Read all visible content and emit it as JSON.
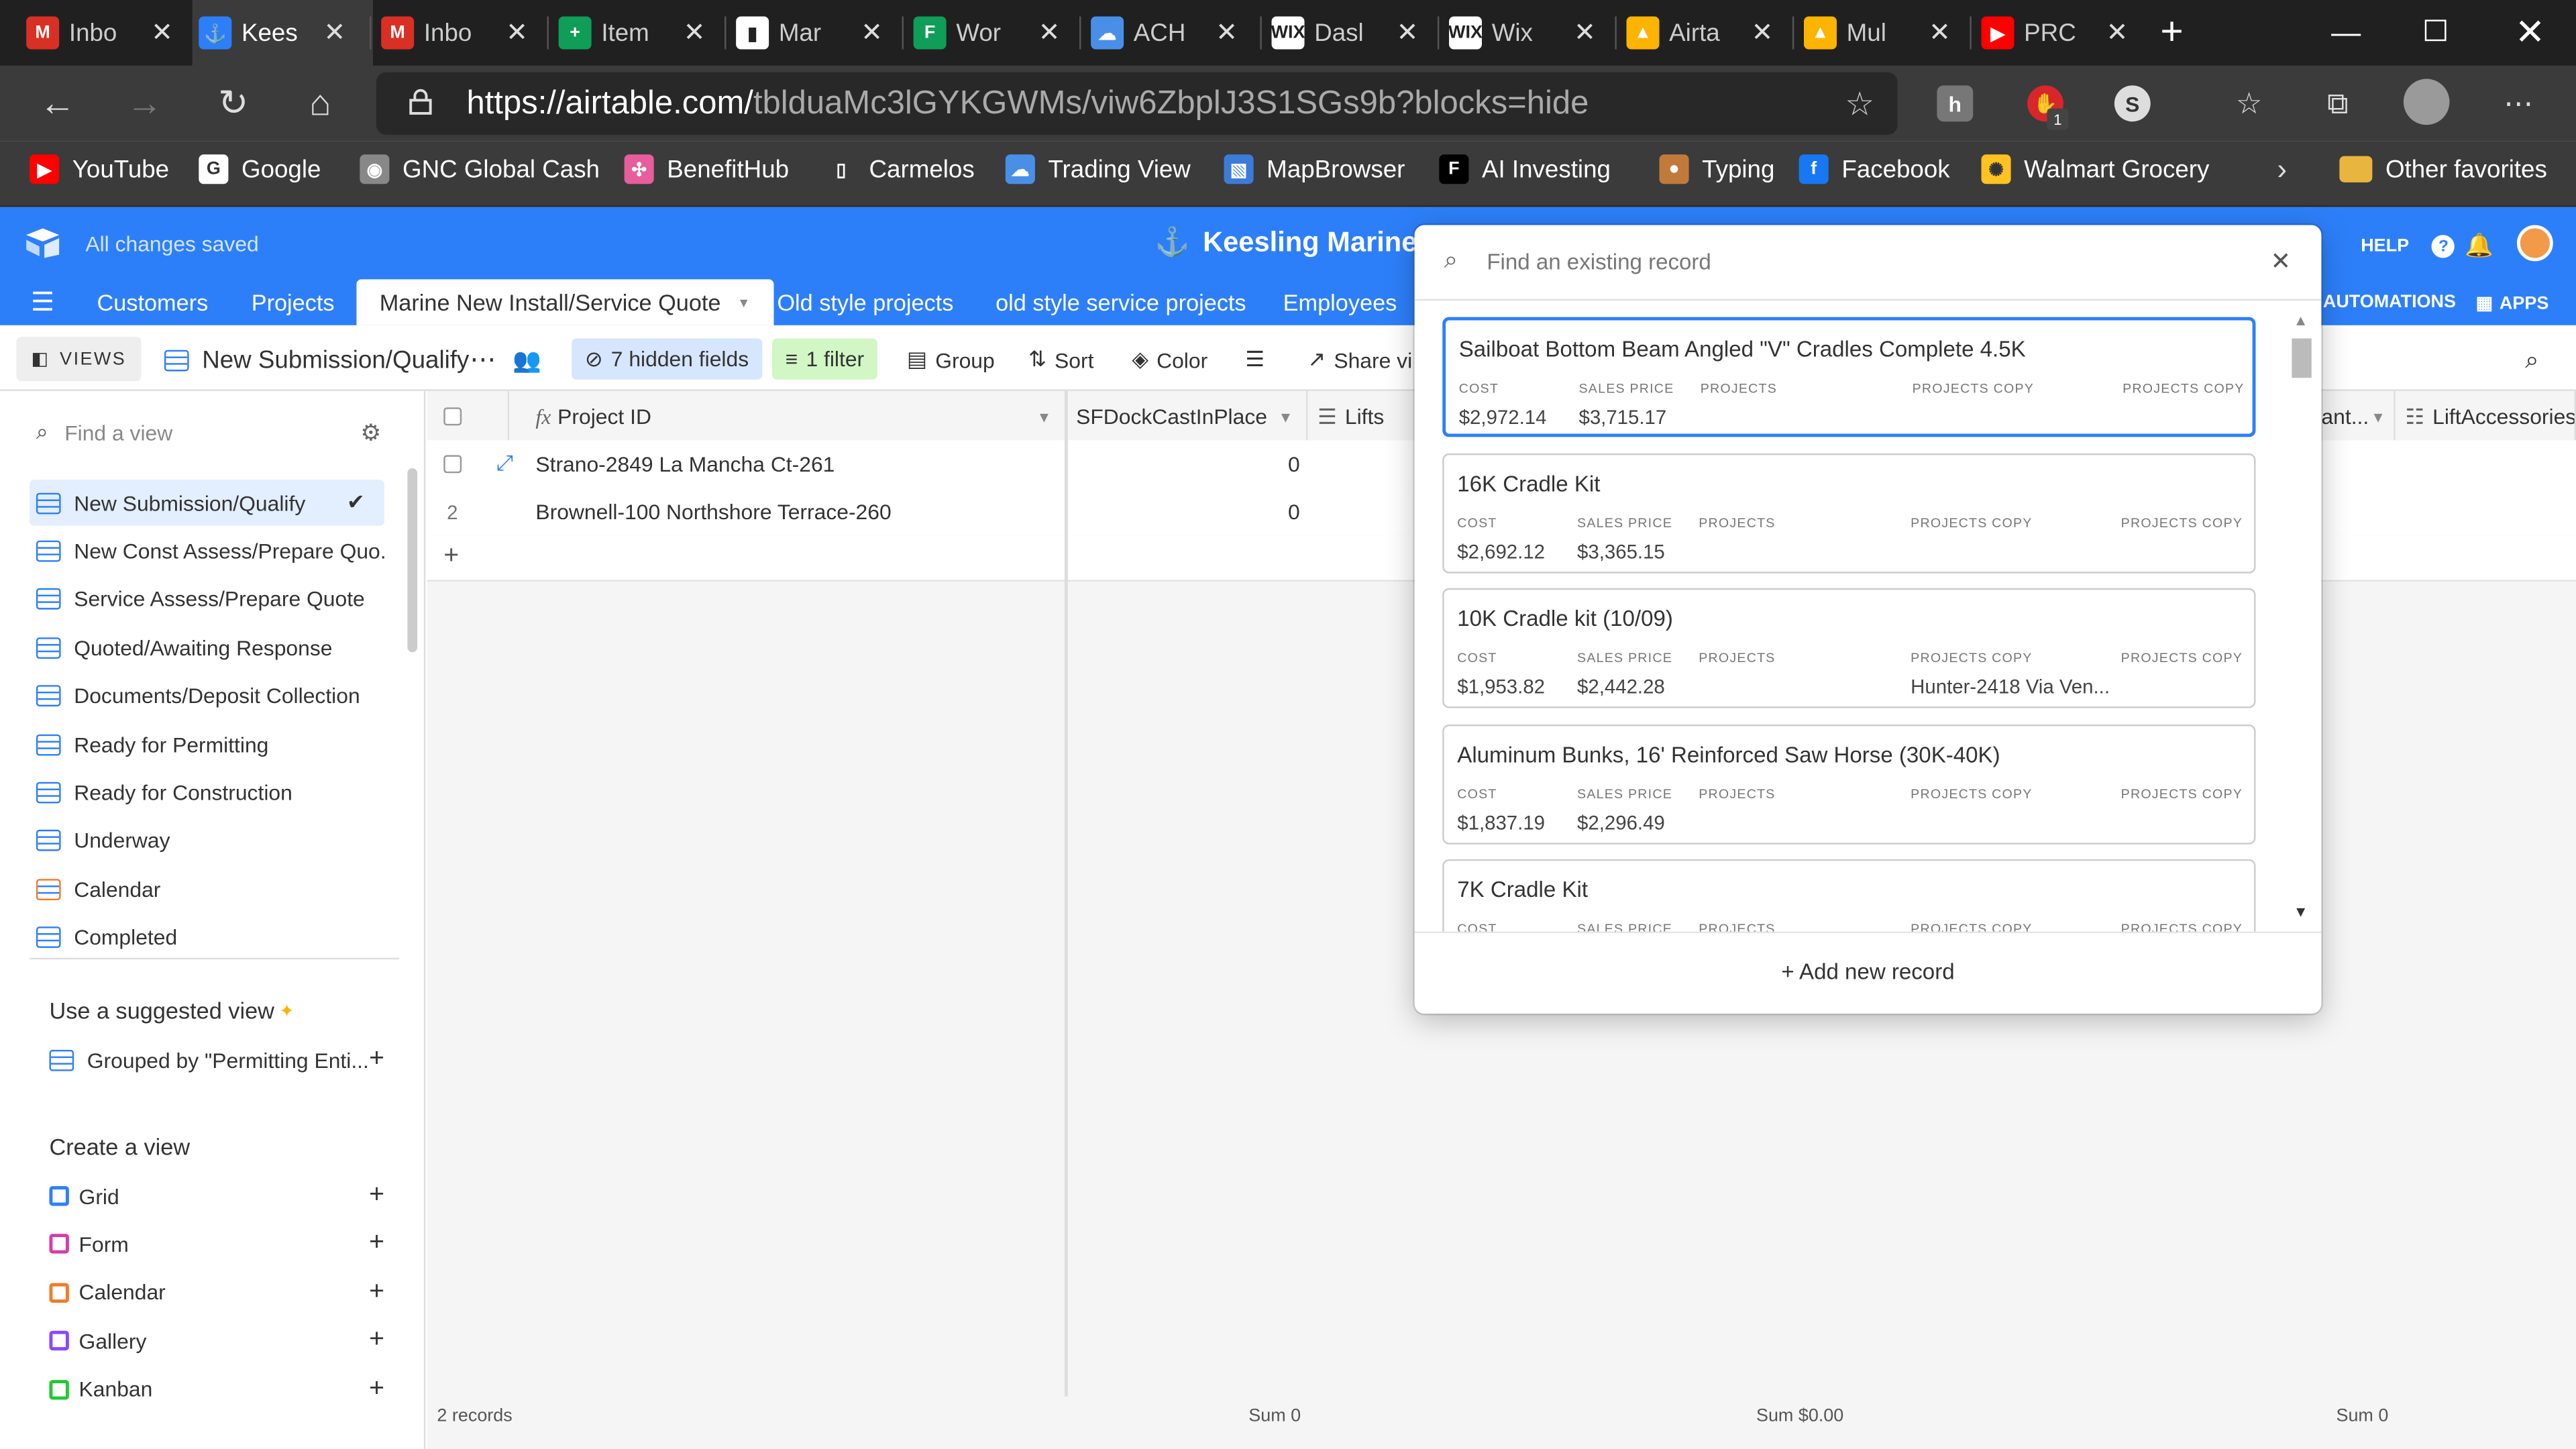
{
  "browser": {
    "tabs": [
      {
        "label": "Inbo",
        "icon": "gmail-icon",
        "color": "#d93025",
        "glyph": "M"
      },
      {
        "label": "Kees",
        "icon": "airtable-anchor-icon",
        "color": "#2d7ff9",
        "glyph": "⚓"
      },
      {
        "label": "Inbo",
        "icon": "gmail-icon",
        "color": "#d93025",
        "glyph": "M"
      },
      {
        "label": "Item",
        "icon": "sheets-icon",
        "color": "#0f9d58",
        "glyph": "+"
      },
      {
        "label": "Mar",
        "icon": "document-icon",
        "color": "#ffffff",
        "glyph": "▮"
      },
      {
        "label": "Wor",
        "icon": "sheets-icon",
        "color": "#0f9d58",
        "glyph": "F"
      },
      {
        "label": "ACH",
        "icon": "cloud-icon",
        "color": "#4a8fe7",
        "glyph": "☁"
      },
      {
        "label": "Dasl",
        "icon": "wix-icon",
        "color": "#ffffff",
        "glyph": "WIX"
      },
      {
        "label": "Wix",
        "icon": "wix-icon",
        "color": "#ffffff",
        "glyph": "WIX"
      },
      {
        "label": "Airta",
        "icon": "airtable-icon",
        "color": "#fcb400",
        "glyph": "▲"
      },
      {
        "label": "Mul",
        "icon": "airtable-icon",
        "color": "#fcb400",
        "glyph": "▲"
      },
      {
        "label": "PRC",
        "icon": "youtube-icon",
        "color": "#ff0000",
        "glyph": "▶"
      }
    ],
    "url_host": "https://airtable.com/",
    "url_path": "tblduaMc3lGYKGWMs/viw6ZbplJ3S1SGs9b?blocks=hide",
    "bookmarks": [
      {
        "label": "YouTube",
        "icon": "youtube-icon",
        "color": "#ff0000",
        "glyph": "▶"
      },
      {
        "label": "Google",
        "icon": "google-icon",
        "color": "#ffffff",
        "glyph": "G"
      },
      {
        "label": "GNC Global Cash",
        "icon": "globe-icon",
        "color": "#888888",
        "glyph": "◉"
      },
      {
        "label": "BenefitHub",
        "icon": "benefithub-icon",
        "color": "#e85d9b",
        "glyph": "✣"
      },
      {
        "label": "Carmelos",
        "icon": "document-icon",
        "color": "#3b3b3b",
        "glyph": "▯"
      },
      {
        "label": "Trading View",
        "icon": "cloud-icon",
        "color": "#4a8fe7",
        "glyph": "☁"
      },
      {
        "label": "MapBrowser",
        "icon": "map-icon",
        "color": "#3d7bd9",
        "glyph": "▧"
      },
      {
        "label": "AI Investing",
        "icon": "f-icon",
        "color": "#000000",
        "glyph": "F"
      },
      {
        "label": "Typing",
        "icon": "typing-icon",
        "color": "#c27a3a",
        "glyph": "●"
      },
      {
        "label": "Facebook",
        "icon": "facebook-icon",
        "color": "#1877f2",
        "glyph": "f"
      },
      {
        "label": "Walmart Grocery",
        "icon": "walmart-icon",
        "color": "#ffc220",
        "glyph": "✺"
      }
    ],
    "other_favorites": "Other favorites",
    "extension_badge": "1"
  },
  "app": {
    "saved_status": "All changes saved",
    "base_name": "Keesling Marine",
    "help": "HELP",
    "automations": "AUTOMATIONS",
    "apps": "APPS",
    "tables": [
      "Customers",
      "Projects",
      "Marine New Install/Service Quote",
      "Old style projects",
      "old style service projects",
      "Employees"
    ],
    "active_table_index": 2
  },
  "viewbar": {
    "views_label": "VIEWS",
    "current_view": "New Submission/Qualify",
    "hidden_fields": "7 hidden fields",
    "filter": "1 filter",
    "group": "Group",
    "sort": "Sort",
    "color": "Color",
    "share": "Share vie"
  },
  "sidebar": {
    "find_placeholder": "Find a view",
    "views": [
      {
        "label": "New Submission/Qualify",
        "type": "grid"
      },
      {
        "label": "New Const Assess/Prepare Quo...",
        "type": "grid"
      },
      {
        "label": "Service Assess/Prepare Quote",
        "type": "grid"
      },
      {
        "label": "Quoted/Awaiting Response",
        "type": "grid"
      },
      {
        "label": "Documents/Deposit Collection",
        "type": "grid"
      },
      {
        "label": "Ready for Permitting",
        "type": "grid"
      },
      {
        "label": "Ready for Construction",
        "type": "grid"
      },
      {
        "label": "Underway",
        "type": "grid"
      },
      {
        "label": "Calendar",
        "type": "calendar"
      },
      {
        "label": "Completed",
        "type": "grid"
      }
    ],
    "suggested_title": "Use a suggested view",
    "suggested_item": "Grouped by \"Permitting Enti...",
    "create_title": "Create a view",
    "create_items": [
      {
        "label": "Grid",
        "color": "#2d7ff9"
      },
      {
        "label": "Form",
        "color": "#d63ca8"
      },
      {
        "label": "Calendar",
        "color": "#f07c2a"
      },
      {
        "label": "Gallery",
        "color": "#8b46ff"
      },
      {
        "label": "Kanban",
        "color": "#20c933"
      }
    ]
  },
  "grid": {
    "columns": {
      "project_id": "Project ID",
      "sf_dock": "SFDockCastInPlace",
      "lifts": "Lifts",
      "ant": "ant...",
      "lift_accessories": "LiftAccessoriesSa"
    },
    "rows": [
      {
        "num": "",
        "project_id": "Strano-2849 La Mancha Ct-261",
        "sf_dock": "0"
      },
      {
        "num": "2",
        "project_id": "Brownell-100 Northshore Terrace-260",
        "sf_dock": "0"
      }
    ],
    "add_row": "+",
    "footer": {
      "records": "2 records",
      "sum1": "Sum 0",
      "sum2": "Sum $0.00",
      "sum3": "Sum 0"
    }
  },
  "popup": {
    "search_placeholder": "Find an existing record",
    "labels": {
      "cost": "COST",
      "sales_price": "SALES PRICE",
      "projects": "PROJECTS",
      "projects_copy": "PROJECTS COPY",
      "projects_copy2": "PROJECTS COPY"
    },
    "records": [
      {
        "title": "Sailboat Bottom Beam Angled \"V\" Cradles Complete 4.5K",
        "cost": "$2,972.14",
        "sales_price": "$3,715.17",
        "projects_copy": ""
      },
      {
        "title": "16K Cradle Kit",
        "cost": "$2,692.12",
        "sales_price": "$3,365.15",
        "projects_copy": ""
      },
      {
        "title": "10K Cradle kit (10/09)",
        "cost": "$1,953.82",
        "sales_price": "$2,442.28",
        "projects_copy": "Hunter-2418 Via Ven..."
      },
      {
        "title": "Aluminum Bunks, 16' Reinforced Saw Horse (30K-40K)",
        "cost": "$1,837.19",
        "sales_price": "$2,296.49",
        "projects_copy": ""
      },
      {
        "title": "7K Cradle Kit",
        "cost": "",
        "sales_price": "",
        "projects_copy": ""
      }
    ],
    "add_new": "+ Add new record"
  }
}
